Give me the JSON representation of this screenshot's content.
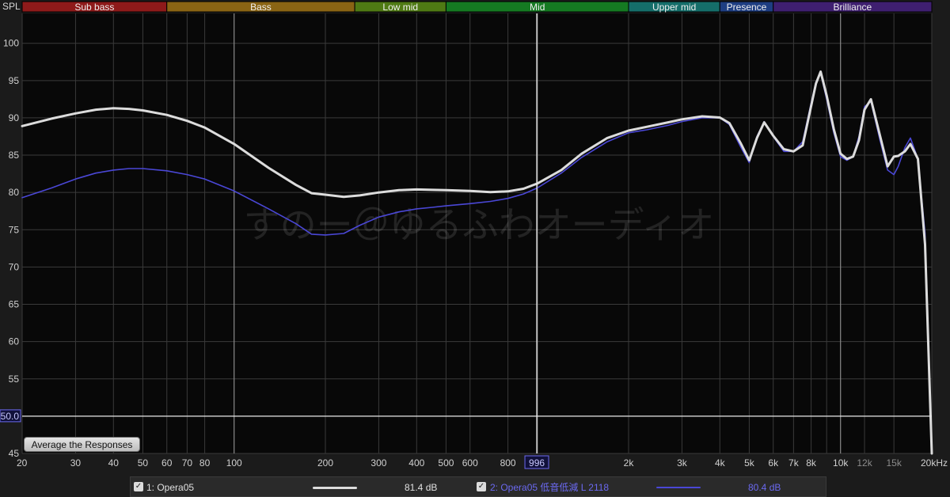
{
  "chart_data": {
    "type": "line",
    "ylabel": "SPL",
    "xscale": "log",
    "xlim": [
      20,
      20000
    ],
    "ylim": [
      45,
      104
    ],
    "grid": true,
    "y_ticks": [
      45,
      50,
      55,
      60,
      65,
      70,
      75,
      80,
      85,
      90,
      95,
      100
    ],
    "x_ticks": [
      {
        "v": 20,
        "label": "20"
      },
      {
        "v": 30,
        "label": "30"
      },
      {
        "v": 40,
        "label": "40"
      },
      {
        "v": 50,
        "label": "50"
      },
      {
        "v": 60,
        "label": "60"
      },
      {
        "v": 70,
        "label": "70"
      },
      {
        "v": 80,
        "label": "80"
      },
      {
        "v": 100,
        "label": "100"
      },
      {
        "v": 200,
        "label": "200"
      },
      {
        "v": 300,
        "label": "300"
      },
      {
        "v": 400,
        "label": "400"
      },
      {
        "v": 500,
        "label": "500"
      },
      {
        "v": 600,
        "label": "600"
      },
      {
        "v": 800,
        "label": "800"
      },
      {
        "v": 2000,
        "label": "2k"
      },
      {
        "v": 3000,
        "label": "3k"
      },
      {
        "v": 4000,
        "label": "4k"
      },
      {
        "v": 5000,
        "label": "5k"
      },
      {
        "v": 6000,
        "label": "6k"
      },
      {
        "v": 7000,
        "label": "7k"
      },
      {
        "v": 8000,
        "label": "8k"
      },
      {
        "v": 10000,
        "label": "10k"
      },
      {
        "v": 12000,
        "label": "12k",
        "dim": true
      },
      {
        "v": 15000,
        "label": "15k",
        "dim": true
      },
      {
        "v": 20000,
        "label": "20kHz"
      }
    ],
    "bands": [
      {
        "name": "Sub bass",
        "from": 20,
        "to": 60,
        "color": "#8e1a1a"
      },
      {
        "name": "Bass",
        "from": 60,
        "to": 250,
        "color": "#8a6414"
      },
      {
        "name": "Low mid",
        "from": 250,
        "to": 500,
        "color": "#4f7a14"
      },
      {
        "name": "Mid",
        "from": 500,
        "to": 2000,
        "color": "#157a22"
      },
      {
        "name": "Upper mid",
        "from": 2000,
        "to": 4000,
        "color": "#156e6a"
      },
      {
        "name": "Presence",
        "from": 4000,
        "to": 6000,
        "color": "#1e3e82"
      },
      {
        "name": "Brilliance",
        "from": 6000,
        "to": 20000,
        "color": "#3f1f70"
      }
    ],
    "cursor": {
      "x": 996,
      "x_label": "996",
      "y": 50,
      "y_label": "50.0"
    },
    "watermark": "すのー＠ゆるふわオーディオ",
    "series": [
      {
        "name": "1: Opera05",
        "avg": "81.4 dB",
        "color": "#dcdcdc",
        "x": [
          20,
          25,
          30,
          35,
          40,
          45,
          50,
          60,
          70,
          80,
          100,
          130,
          160,
          180,
          200,
          230,
          260,
          300,
          350,
          400,
          450,
          500,
          600,
          700,
          800,
          900,
          1000,
          1200,
          1400,
          1700,
          2000,
          2300,
          2700,
          3000,
          3500,
          4000,
          4300,
          4700,
          5000,
          5300,
          5600,
          6000,
          6500,
          7000,
          7500,
          8000,
          8300,
          8600,
          9000,
          9500,
          10000,
          10500,
          11000,
          11500,
          12000,
          12600,
          13500,
          14300,
          15000,
          15500,
          16300,
          17000,
          18000,
          19000,
          20000
        ],
        "y": [
          88.9,
          89.9,
          90.6,
          91.1,
          91.3,
          91.2,
          91.0,
          90.4,
          89.6,
          88.7,
          86.5,
          83.3,
          81.0,
          79.9,
          79.7,
          79.4,
          79.6,
          80.0,
          80.3,
          80.4,
          80.35,
          80.3,
          80.2,
          80.05,
          80.15,
          80.5,
          81.2,
          83.0,
          85.2,
          87.3,
          88.3,
          88.8,
          89.4,
          89.8,
          90.2,
          90.05,
          89.3,
          86.5,
          84.3,
          87.3,
          89.4,
          87.6,
          85.8,
          85.5,
          86.3,
          91.6,
          94.6,
          96.2,
          93.0,
          88.5,
          85.2,
          84.5,
          84.8,
          87.0,
          91.1,
          92.5,
          87.6,
          83.5,
          84.8,
          84.9,
          85.5,
          86.5,
          84.5,
          73.0,
          45.0
        ]
      },
      {
        "name": "2: Opera05 低音低減 L 2118",
        "avg": "80.4 dB",
        "color": "#4a47d6",
        "x": [
          20,
          25,
          30,
          35,
          40,
          45,
          50,
          60,
          70,
          80,
          100,
          130,
          160,
          180,
          200,
          230,
          260,
          300,
          350,
          400,
          450,
          500,
          600,
          700,
          800,
          900,
          1000,
          1200,
          1400,
          1700,
          2000,
          2300,
          2700,
          3000,
          3500,
          4000,
          4300,
          4700,
          5000,
          5300,
          5600,
          6000,
          6500,
          7000,
          7500,
          8000,
          8300,
          8600,
          9000,
          9500,
          10000,
          10500,
          11000,
          11500,
          12000,
          12600,
          13500,
          14300,
          15000,
          15500,
          16300,
          17000,
          18000,
          19000,
          20000
        ],
        "y": [
          79.3,
          80.6,
          81.8,
          82.6,
          83.0,
          83.2,
          83.2,
          82.9,
          82.4,
          81.8,
          80.2,
          77.8,
          75.8,
          74.4,
          74.3,
          74.5,
          75.6,
          76.7,
          77.4,
          77.8,
          78.0,
          78.2,
          78.5,
          78.8,
          79.2,
          79.8,
          80.6,
          82.6,
          84.7,
          86.8,
          88.0,
          88.4,
          89.0,
          89.5,
          90.0,
          90.0,
          89.1,
          86.0,
          84.0,
          87.5,
          89.5,
          87.5,
          85.5,
          85.5,
          86.8,
          92.0,
          94.8,
          96.0,
          92.5,
          88.0,
          84.8,
          84.3,
          84.8,
          87.5,
          91.5,
          92.2,
          87.0,
          83.0,
          82.4,
          83.5,
          86.0,
          87.3,
          84.5,
          74.5,
          45.0
        ]
      }
    ]
  },
  "ui": {
    "average_button": "Average the Responses"
  },
  "legend": {
    "items": [
      {
        "label": "1: Opera05",
        "value": "81.4 dB",
        "checked": "✓",
        "text_color": "#dcdcdc"
      },
      {
        "label": "2: Opera05 低音低減 L 2118",
        "value": "80.4 dB",
        "checked": "✓",
        "text_color": "#6b69f0"
      }
    ]
  }
}
